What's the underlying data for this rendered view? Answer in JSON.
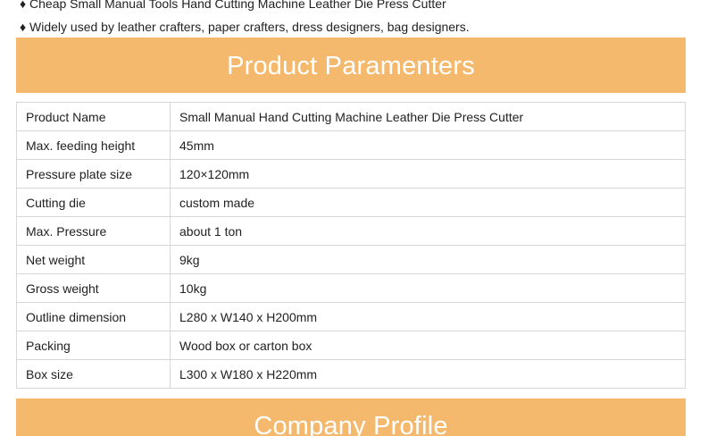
{
  "bullets": [
    "♦ Cheap Small Manual Tools Hand Cutting Machine Leather Die Press Cutter",
    "♦ Widely used by leather crafters, paper crafters, dress designers, bag designers."
  ],
  "params_heading": "Product Paramenters",
  "specs": [
    {
      "label": "Product Name",
      "value": "Small Manual Hand Cutting Machine Leather Die Press Cutter"
    },
    {
      "label": "Max. feeding height",
      "value": "45mm"
    },
    {
      "label": "Pressure plate size",
      "value": "120×120mm"
    },
    {
      "label": "Cutting die",
      "value": "custom made"
    },
    {
      "label": "Max. Pressure",
      "value": "about 1 ton"
    },
    {
      "label": "Net weight",
      "value": "9kg"
    },
    {
      "label": "Gross weight",
      "value": "10kg"
    },
    {
      "label": "Outline dimension",
      "value": "L280 x W140 x H200mm"
    },
    {
      "label": "Packing",
      "value": "Wood box or carton box"
    },
    {
      "label": "Box size",
      "value": "L300 x W180 x H220mm"
    }
  ],
  "company_heading": "Company Profile",
  "colors": {
    "banner": "#f4b96c",
    "banner_text": "#ffffff",
    "border": "#d7d7d7"
  }
}
